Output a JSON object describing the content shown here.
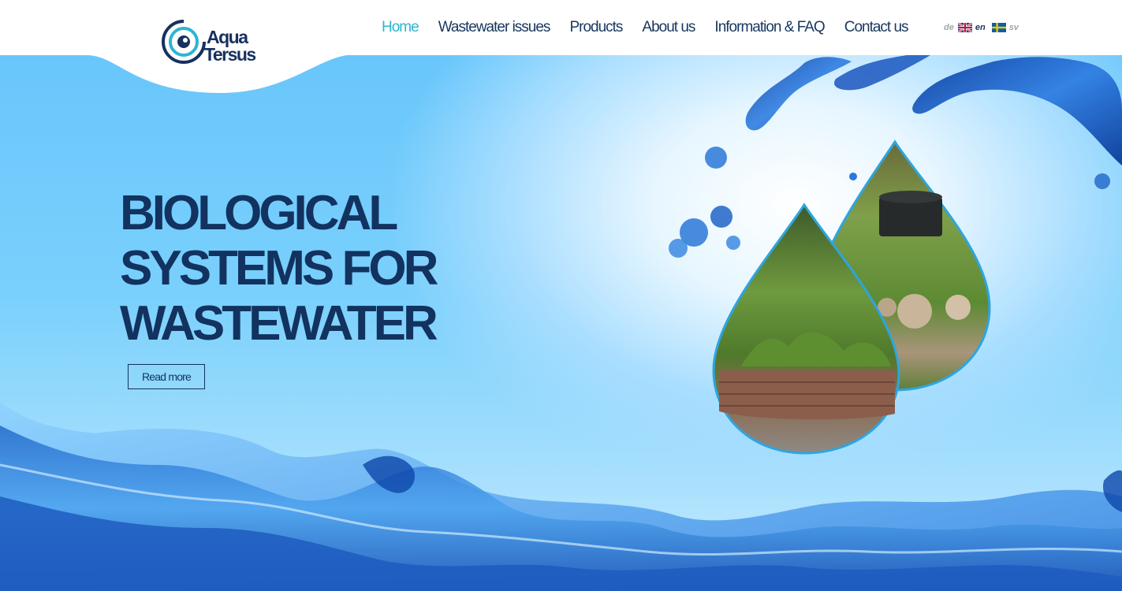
{
  "brand": {
    "name_line1": "Aqua",
    "name_line2": "Tersus"
  },
  "nav": {
    "items": [
      {
        "label": "Home",
        "active": true
      },
      {
        "label": "Wastewater issues",
        "active": false
      },
      {
        "label": "Products",
        "active": false
      },
      {
        "label": "About us",
        "active": false
      },
      {
        "label": "Information & FAQ",
        "active": false
      },
      {
        "label": "Contact us",
        "active": false
      }
    ]
  },
  "languages": {
    "de": "de",
    "en": "en",
    "sv": "sv",
    "current": "en"
  },
  "hero": {
    "headline_line1": "BIOLOGICAL",
    "headline_line2": "SYSTEMS FOR",
    "headline_line3": "WASTEWATER",
    "read_more_label": "Read more"
  },
  "icons": {
    "logo": "aqua-tersus-logo-icon",
    "uk_flag": "uk-flag-icon",
    "se_flag": "sweden-flag-icon"
  },
  "colors": {
    "nav_text": "#17375e",
    "nav_active": "#2db4d4",
    "headline": "#12325f",
    "sky_blue": "#69c6fb"
  }
}
